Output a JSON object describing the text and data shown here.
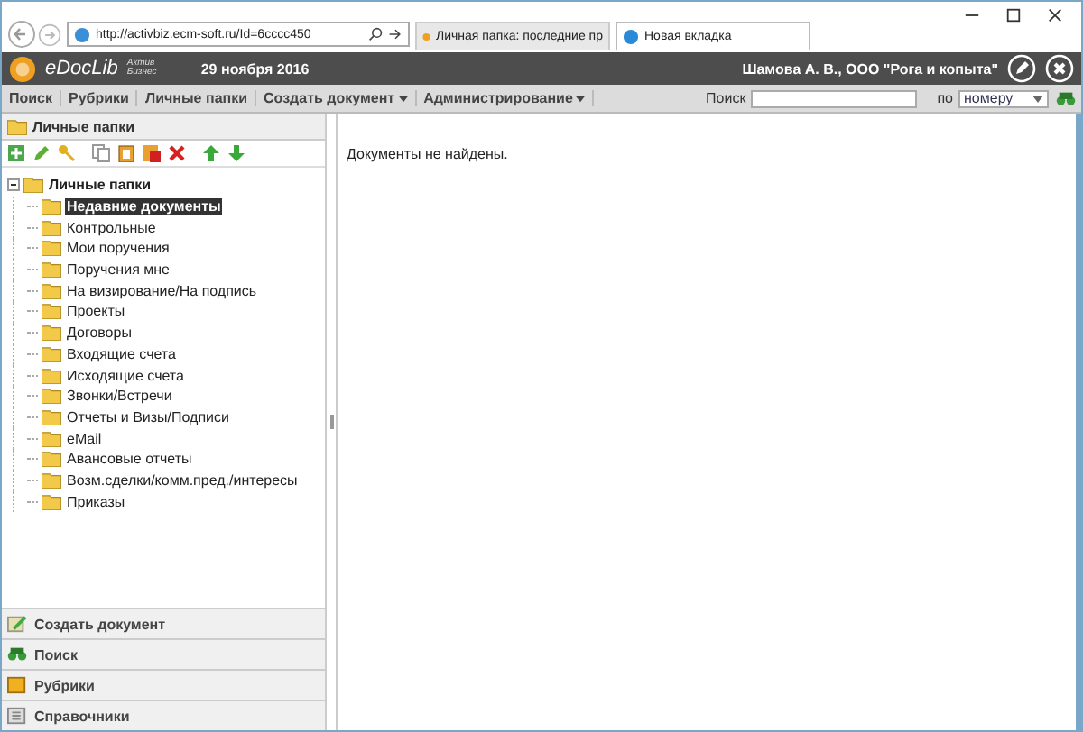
{
  "browser": {
    "address": "http://activbiz.ecm-soft.ru/Id=6cccc450",
    "tabs": [
      {
        "label": "Личная папка: последние пр",
        "selected": false
      },
      {
        "label": "Новая вкладка",
        "selected": true
      }
    ]
  },
  "header": {
    "logo": "eDocLib",
    "logo_subtitle": "Актив Бизнес",
    "date": "29 ноября 2016",
    "user": "Шамова А. В., ООО \"Рога и копыта\""
  },
  "menu": [
    {
      "label": "Поиск",
      "dropdown": false
    },
    {
      "label": "Рубрики",
      "dropdown": false
    },
    {
      "label": "Личные папки",
      "dropdown": false
    },
    {
      "label": "Создать документ",
      "dropdown": true
    },
    {
      "label": "Администрирование",
      "dropdown": true
    }
  ],
  "search": {
    "label": "Поиск",
    "by_label": "по",
    "by_value": "номеру"
  },
  "sidebar": {
    "title": "Личные папки",
    "tree": [
      {
        "label": "Личные папки",
        "expanded": true,
        "selected": false,
        "children": [
          {
            "label": "Недавние документы",
            "selected": true
          },
          {
            "label": "Контрольные",
            "selected": false
          },
          {
            "label": "Мои поручения",
            "selected": false
          },
          {
            "label": "Поручения мне",
            "selected": false
          },
          {
            "label": "На визирование/На подпись",
            "selected": false
          },
          {
            "label": "Проекты",
            "selected": false
          },
          {
            "label": "Договоры",
            "selected": false
          },
          {
            "label": "Входящие счета",
            "selected": false
          },
          {
            "label": "Исходящие счета",
            "selected": false
          },
          {
            "label": "Звонки/Встречи",
            "selected": false
          },
          {
            "label": "Отчеты и Визы/Подписи",
            "selected": false
          },
          {
            "label": "eMail",
            "selected": false
          },
          {
            "label": "Авансовые отчеты",
            "selected": false
          },
          {
            "label": "Возм.сделки/комм.пред./интересы",
            "selected": false
          },
          {
            "label": "Приказы",
            "selected": false
          }
        ]
      }
    ],
    "sections": [
      {
        "label": "Создать документ",
        "kind": "create"
      },
      {
        "label": "Поиск",
        "kind": "search"
      },
      {
        "label": "Рубрики",
        "kind": "rubric"
      },
      {
        "label": "Справочники",
        "kind": "reference"
      }
    ]
  },
  "content": {
    "message": "Документы не найдены."
  }
}
